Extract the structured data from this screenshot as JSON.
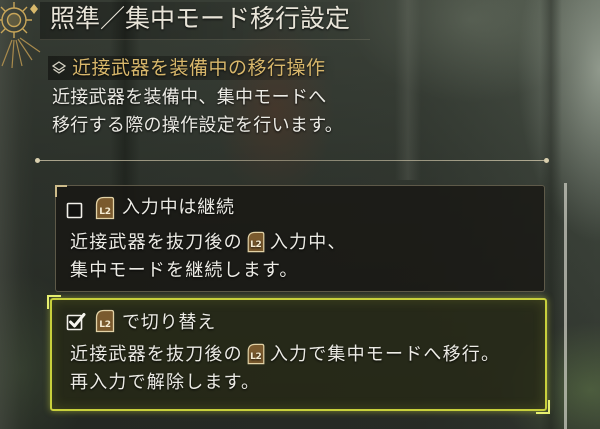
{
  "screen": {
    "title": "照準／集中モード移行設定",
    "emblem_icon": "ornate-emblem-icon"
  },
  "section": {
    "icon": "layered-diamond-icon",
    "heading": "近接武器を装備中の移行操作",
    "description": [
      "近接武器を装備中、集中モードへ",
      "移行する際の操作設定を行います。"
    ]
  },
  "options": [
    {
      "checked": false,
      "selected": false,
      "checkbox_icon": "checkbox-empty-icon",
      "button_icon": "l2-trigger-icon",
      "button_glyph": "L2",
      "label": "入力中は継続",
      "description": {
        "line1_before": "近接武器を抜刀後の",
        "line1_glyph": "L2",
        "line1_after": "入力中、",
        "line2": "集中モードを継続します。"
      }
    },
    {
      "checked": true,
      "selected": true,
      "checkbox_icon": "checkbox-checked-icon",
      "button_icon": "l2-trigger-icon",
      "button_glyph": "L2",
      "label": "で切り替え",
      "description": {
        "line1_before": "近接武器を抜刀後の",
        "line1_glyph": "L2",
        "line1_after": "入力で集中モードへ移行。",
        "line2": "再入力で解除します。"
      }
    }
  ],
  "colors": {
    "title": "#e8e4d8",
    "heading": "#d8b76b",
    "text": "#ecebe5",
    "selected_border": "#c8d03c",
    "panel": "#1d1c18",
    "glyph_fill": "#7a5a2e",
    "glyph_border": "#e2d2a6"
  }
}
